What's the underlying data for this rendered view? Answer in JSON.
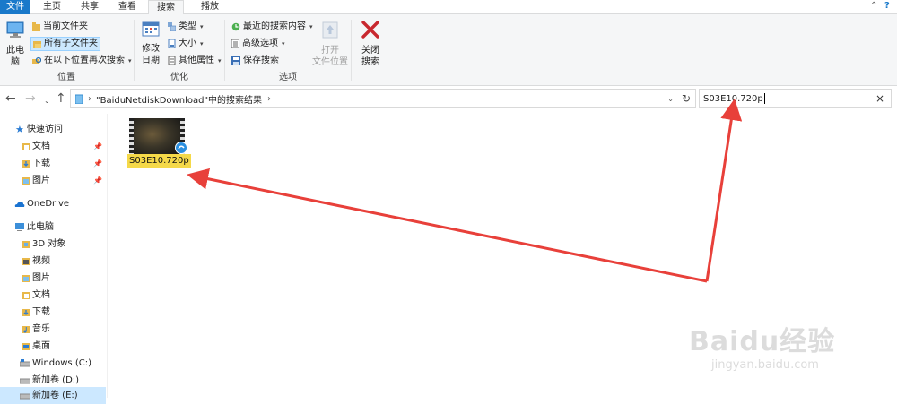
{
  "ribbon_tabs": {
    "file": "文件",
    "home": "主页",
    "share": "共享",
    "view": "查看",
    "search": "搜索",
    "play": "播放"
  },
  "ribbon": {
    "location": {
      "this_pc": "此电\n脑",
      "current_folder": "当前文件夹",
      "all_subfolders": "所有子文件夹",
      "search_again": "在以下位置再次搜索",
      "label": "位置"
    },
    "refine": {
      "date_modified": "修改\n日期",
      "type": "类型",
      "size": "大小",
      "other_props": "其他属性",
      "label": "优化"
    },
    "options": {
      "recent_searches": "最近的搜索内容",
      "advanced": "高级选项",
      "save_search": "保存搜索",
      "open_location": "打开\n文件位置",
      "label": "选项"
    },
    "close": {
      "close_search": "关闭\n搜索"
    }
  },
  "address": {
    "path": "\"BaiduNetdiskDownload\"中的搜索结果",
    "search_value": "S03E10.720p"
  },
  "sidebar": {
    "quick_access": "快速访问",
    "qa_docs": "文档",
    "qa_downloads": "下载",
    "qa_pictures": "图片",
    "onedrive": "OneDrive",
    "this_pc": "此电脑",
    "objects3d": "3D 对象",
    "videos": "视频",
    "pictures": "图片",
    "docs": "文档",
    "downloads": "下载",
    "music": "音乐",
    "desktop": "桌面",
    "drive_c": "Windows (C:)",
    "drive_d": "新加卷 (D:)",
    "drive_e": "新加卷 (E:)"
  },
  "results": [
    {
      "name": "S03E10.720p"
    }
  ],
  "watermark": {
    "logo": "Baidu经验",
    "url": "jingyan.baidu.com"
  },
  "colors": {
    "accent": "#1979ca",
    "selection": "#cce8ff",
    "annotation_arrow": "#e8403a"
  }
}
